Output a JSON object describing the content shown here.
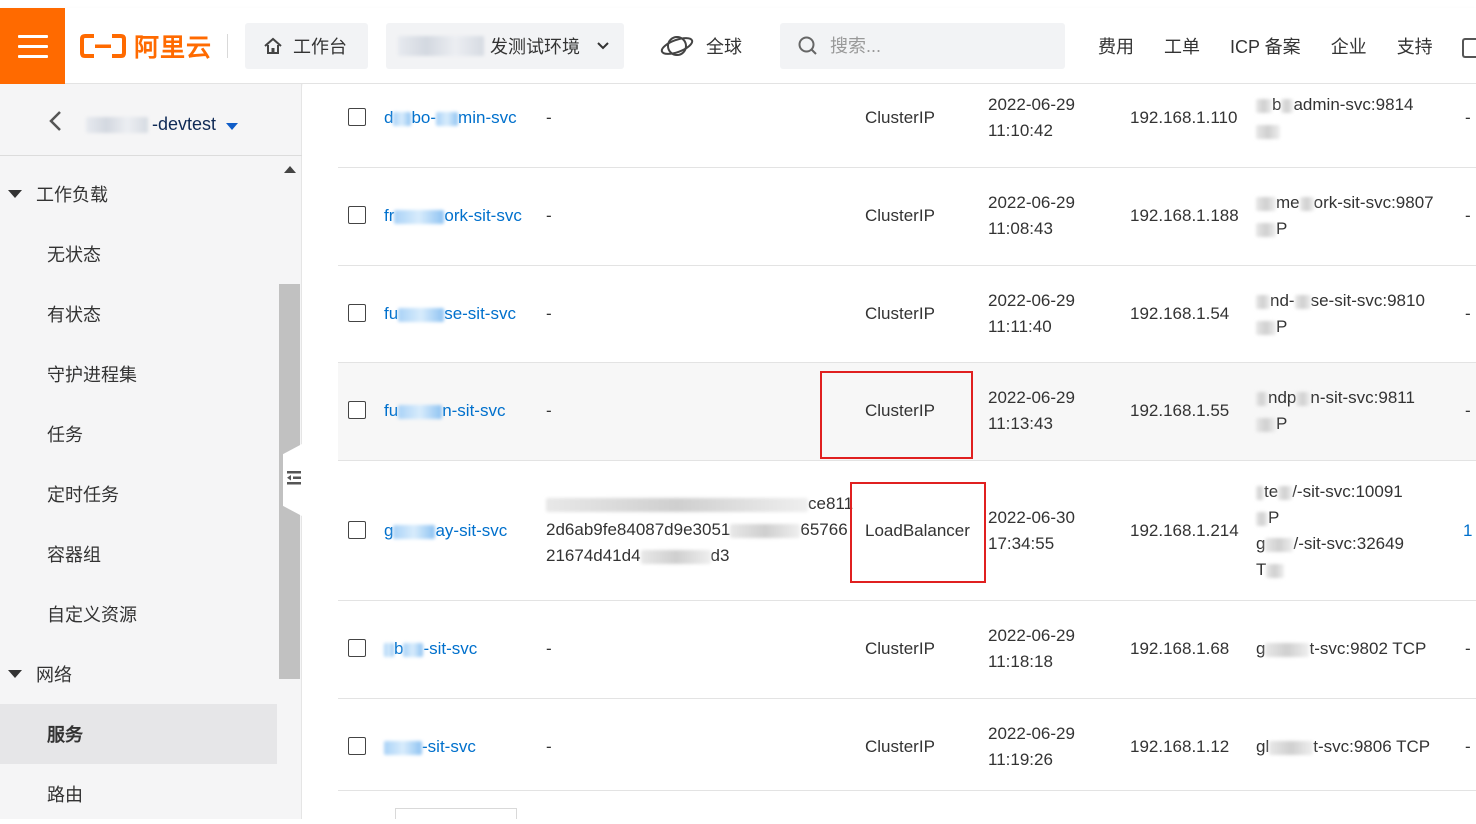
{
  "topbar": {
    "brand_color": "#ff6a00",
    "logo_text": "阿里云",
    "workbench_label": "工作台",
    "env_label": "发测试环境",
    "region_label": "全球",
    "search_placeholder": "搜索...",
    "links": [
      "费用",
      "工单",
      "ICP 备案",
      "企业",
      "支持"
    ]
  },
  "sidebar": {
    "cluster_name": "-devtest",
    "groups": [
      {
        "label": "工作负载",
        "items": [
          "无状态",
          "有状态",
          "守护进程集",
          "任务",
          "定时任务",
          "容器组",
          "自定义资源"
        ]
      },
      {
        "label": "网络",
        "items": [
          "服务",
          "路由"
        ]
      }
    ],
    "active_item": "服务"
  },
  "table": {
    "accent_link": "#0070cc",
    "highlight_color": "#e02020",
    "rows": [
      {
        "name_a": "d",
        "name_b": "bo-",
        "name_c": "min-svc",
        "cluster_ip_extra": "-",
        "type": "ClusterIP",
        "created_date": "2022-06-29",
        "created_time": "11:10:42",
        "ip": "192.168.1.110",
        "endpoint_1": "b",
        "endpoint_2": "admin-svc:9814",
        "endpoint_3": "",
        "tail": "-"
      },
      {
        "name_a": "fr",
        "name_b": "",
        "name_c": "ork-sit-svc",
        "cluster_ip_extra": "-",
        "type": "ClusterIP",
        "created_date": "2022-06-29",
        "created_time": "11:08:43",
        "ip": "192.168.1.188",
        "endpoint_1": "me",
        "endpoint_2": "ork-sit-svc:9807",
        "endpoint_3": "P",
        "tail": "-"
      },
      {
        "name_a": "fu",
        "name_b": "",
        "name_c": "se-sit-svc",
        "cluster_ip_extra": "-",
        "type": "ClusterIP",
        "created_date": "2022-06-29",
        "created_time": "11:11:40",
        "ip": "192.168.1.54",
        "endpoint_1": "nd-",
        "endpoint_2": "se-sit-svc:9810",
        "endpoint_3": "P",
        "tail": "-"
      },
      {
        "name_a": "fu",
        "name_b": "",
        "name_c": "n-sit-svc",
        "cluster_ip_extra": "-",
        "type": "ClusterIP",
        "created_date": "2022-06-29",
        "created_time": "11:13:43",
        "ip": "192.168.1.55",
        "endpoint_1": "ndp",
        "endpoint_2": "n-sit-svc:9811",
        "endpoint_3": "P",
        "tail": "-"
      },
      {
        "name_a": "g",
        "name_b": "",
        "name_c": "ay-sit-svc",
        "ext_line1": "ce811",
        "ext_line2a": "2d6ab9fe84087d9e3051",
        "ext_line2b": "65766",
        "ext_line3a": "21674d41d4",
        "ext_line3b": "d3",
        "type": "LoadBalancer",
        "created_date": "2022-06-30",
        "created_time": "17:34:55",
        "ip": "192.168.1.214",
        "endpoint_1": "te",
        "endpoint_2": "/-sit-svc:10091",
        "endpoint_3": "P",
        "endpoint_4": "g",
        "endpoint_5": "/-sit-svc:32649",
        "endpoint_6": "T",
        "tail": "1"
      },
      {
        "name_a": "",
        "name_b": "b",
        "name_c": "-sit-svc",
        "cluster_ip_extra": "-",
        "type": "ClusterIP",
        "created_date": "2022-06-29",
        "created_time": "11:18:18",
        "ip": "192.168.1.68",
        "endpoint_1": "g",
        "endpoint_2": "t-svc:9802 TCP",
        "endpoint_3": "",
        "tail": "-"
      },
      {
        "name_a": "",
        "name_b": "",
        "name_c": "-sit-svc",
        "cluster_ip_extra": "-",
        "type": "ClusterIP",
        "created_date": "2022-06-29",
        "created_time": "11:19:26",
        "ip": "192.168.1.12",
        "endpoint_1": "gl",
        "endpoint_2": "t-svc:9806 TCP",
        "endpoint_3": "",
        "tail": "-"
      }
    ]
  }
}
